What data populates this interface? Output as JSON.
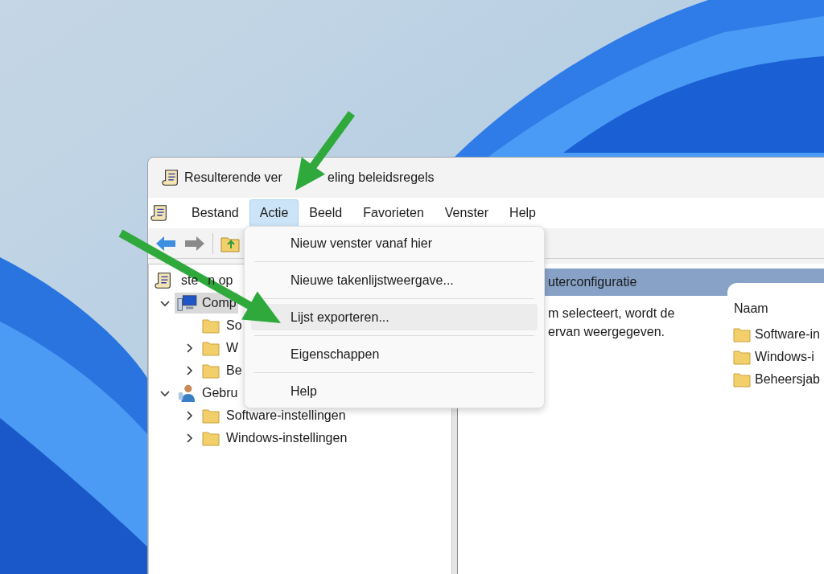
{
  "window": {
    "title_parts": [
      "Resulterende ver",
      "eling beleidsregels"
    ]
  },
  "menu_bar": [
    {
      "label": "Bestand",
      "selected": false
    },
    {
      "label": "Actie",
      "selected": true
    },
    {
      "label": "Beeld",
      "selected": false
    },
    {
      "label": "Favorieten",
      "selected": false
    },
    {
      "label": "Venster",
      "selected": false
    },
    {
      "label": "Help",
      "selected": false
    }
  ],
  "dropdown": [
    {
      "label": "Nieuw venster vanaf hier",
      "highlighted": false
    },
    {
      "label": "Nieuwe takenlijstweergave...",
      "highlighted": false
    },
    {
      "label": "Lijst exporteren...",
      "highlighted": true
    },
    {
      "label": "Eigenschappen",
      "highlighted": false
    },
    {
      "label": "Help",
      "highlighted": false
    }
  ],
  "tree": {
    "root": {
      "label_parts": [
        "ste",
        "n op"
      ]
    },
    "items": [
      {
        "label": "Comp",
        "kind": "computer",
        "expanded": true,
        "selected": true,
        "children": [
          {
            "label": "So",
            "kind": "folder",
            "selected": false
          },
          {
            "label": "W",
            "kind": "folder",
            "expanded": false,
            "selected": false
          },
          {
            "label": "Be",
            "kind": "folder",
            "expanded": false,
            "selected": false
          }
        ]
      },
      {
        "label": "Gebru",
        "kind": "user",
        "expanded": true,
        "selected": false,
        "children": [
          {
            "label": "Software-instellingen",
            "kind": "folder",
            "expanded": false,
            "selected": false
          },
          {
            "label": "Windows-instellingen",
            "kind": "folder",
            "expanded": false,
            "selected": false
          }
        ]
      }
    ]
  },
  "detail": {
    "header": "uterconfiguratie",
    "description": [
      "m selecteert, wordt de",
      "ervan weergegeven."
    ],
    "list_header": "Naam",
    "list_items": [
      "Software-in",
      "Windows-i",
      "Beheersjab"
    ]
  }
}
